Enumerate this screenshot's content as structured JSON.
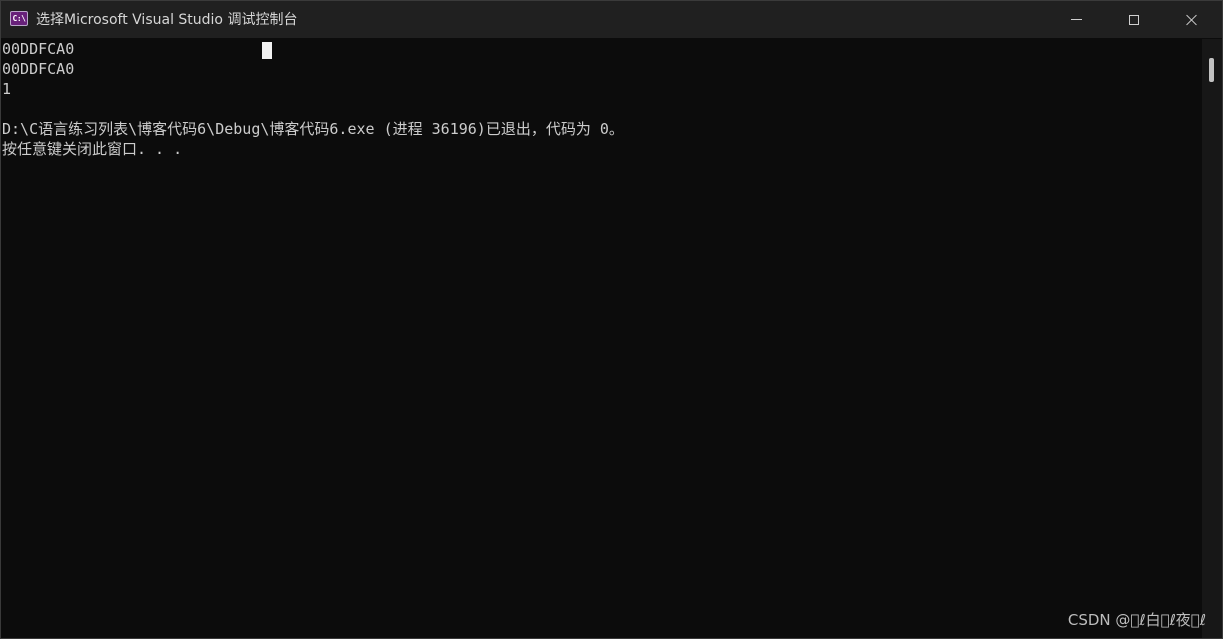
{
  "window": {
    "title": "选择Microsoft Visual Studio 调试控制台",
    "app_icon_label": "C:\\",
    "app_icon_name": "vs-debug-console-icon",
    "controls": {
      "minimize_icon": "minimize-icon",
      "maximize_icon": "maximize-icon",
      "close_icon": "close-icon"
    }
  },
  "console": {
    "lines": [
      "00DDFCA0",
      "00DDFCA0",
      "1",
      "",
      "D:\\C语言练习列表\\博客代码6\\Debug\\博客代码6.exe (进程 36196)已退出，代码为 0。",
      "按任意键关闭此窗口. . ."
    ]
  },
  "watermark": "CSDN @\u0000ℓ白\u0000ℓ夜\u0000ℓ",
  "colors": {
    "background": "#0c0c0c",
    "titlebar": "#202020",
    "text": "#cccccc",
    "icon_accent": "#68217a"
  }
}
